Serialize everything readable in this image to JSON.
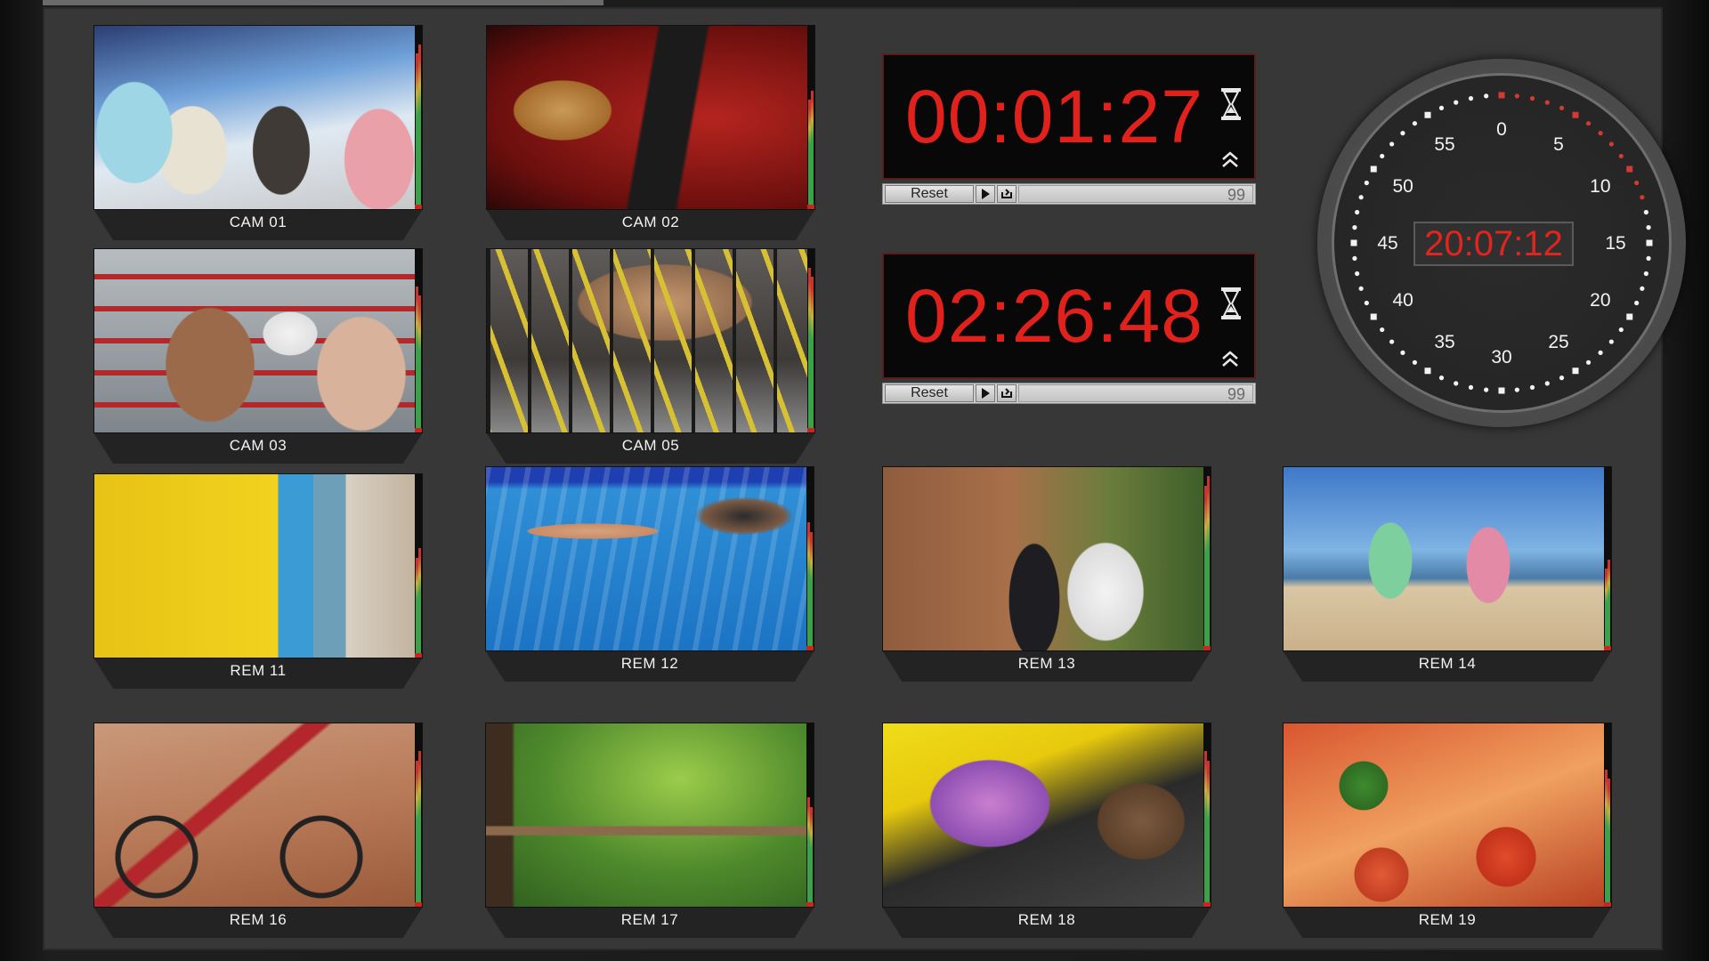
{
  "colors": {
    "tally_red": "#c8261f",
    "timer_red": "#e0211c",
    "clock_second_red": "#d23a33"
  },
  "tiles": [
    {
      "label": "CAM 01",
      "scene": "ski",
      "meter": [
        0.85,
        0.9
      ]
    },
    {
      "label": "CAM 02",
      "scene": "guitar",
      "meter": [
        0.6,
        0.65
      ]
    },
    {
      "label": "CAM 03",
      "scene": "boxing",
      "meter": [
        0.8,
        0.75
      ]
    },
    {
      "label": "CAM 05",
      "scene": "cycling",
      "meter": [
        0.9,
        0.85
      ]
    },
    {
      "label": "REM 11",
      "scene": "street",
      "meter": [
        0.55,
        0.6
      ]
    },
    {
      "label": "REM 12",
      "scene": "swim",
      "meter": [
        0.7,
        0.65
      ]
    },
    {
      "label": "REM 13",
      "scene": "wedding",
      "meter": [
        0.9,
        0.95
      ]
    },
    {
      "label": "REM 14",
      "scene": "beach",
      "meter": [
        0.45,
        0.5
      ]
    },
    {
      "label": "REM 16",
      "scene": "bike",
      "meter": [
        0.8,
        0.85
      ]
    },
    {
      "label": "REM 17",
      "scene": "forest",
      "meter": [
        0.6,
        0.55
      ]
    },
    {
      "label": "REM 18",
      "scene": "moto",
      "meter": [
        0.85,
        0.8
      ]
    },
    {
      "label": "REM 19",
      "scene": "food",
      "meter": [
        0.75,
        0.7
      ]
    }
  ],
  "timers": [
    {
      "time": "00:01:27",
      "reset_label": "Reset",
      "count": "99"
    },
    {
      "time": "02:26:48",
      "reset_label": "Reset",
      "count": "99"
    }
  ],
  "clock": {
    "digital_time": "20:07:12",
    "numbers": [
      "0",
      "5",
      "10",
      "15",
      "20",
      "25",
      "30",
      "35",
      "40",
      "45",
      "50",
      "55"
    ],
    "seconds_elapsed": 12
  },
  "icons": {
    "timer_mode": "hourglass-icon",
    "timer_expand": "chevron-up-icon",
    "play": "play-icon",
    "loop": "loop-icon"
  }
}
